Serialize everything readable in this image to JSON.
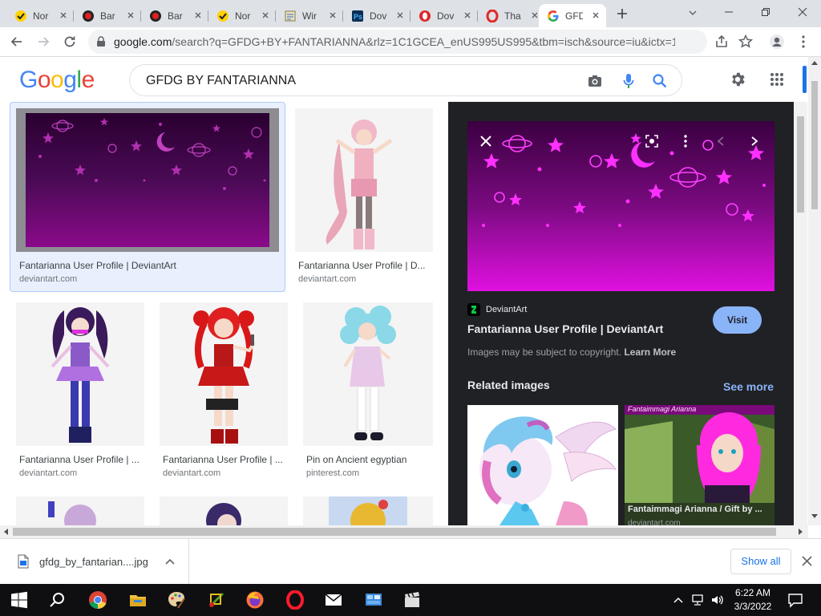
{
  "browser": {
    "tabs": [
      {
        "title": "Nor",
        "favicon": "norton-check-icon",
        "active": false
      },
      {
        "title": "Bar",
        "favicon": "record-icon",
        "active": false
      },
      {
        "title": "Bar",
        "favicon": "record-icon",
        "active": false
      },
      {
        "title": "Nor",
        "favicon": "norton-check-icon",
        "active": false
      },
      {
        "title": "Wir",
        "favicon": "wordpad-icon",
        "active": false
      },
      {
        "title": "Dov",
        "favicon": "ps-icon",
        "active": false
      },
      {
        "title": "Dov",
        "favicon": "opera-q-icon",
        "active": false
      },
      {
        "title": "Tha",
        "favicon": "opera-icon",
        "active": false
      },
      {
        "title": "GFD",
        "favicon": "google-g-icon",
        "active": true
      }
    ],
    "url_host": "google.com",
    "url_rest": "/search?q=GFDG+BY+FANTARIANNA&rlz=1C1GCEA_enUS995US995&tbm=isch&source=iu&ictx=1&vet..."
  },
  "google": {
    "logo": "Google",
    "query": "GFDG BY FANTARIANNA"
  },
  "results": [
    {
      "caption": "Fantarianna User Profile | DeviantArt",
      "source": "deviantart.com"
    },
    {
      "caption": "Fantarianna User Profile | D...",
      "source": "deviantart.com"
    },
    {
      "caption": "Fantarianna User Profile | ...",
      "source": "deviantart.com"
    },
    {
      "caption": "Fantarianna User Profile | ...",
      "source": "deviantart.com"
    },
    {
      "caption": "Pin on Ancient egyptian",
      "source": "pinterest.com"
    }
  ],
  "preview": {
    "site": "DeviantArt",
    "title": "Fantarianna User Profile | DeviantArt",
    "visit": "Visit",
    "copyright": "Images may be subject to copyright.",
    "learn_more": "Learn More",
    "related": "Related images",
    "see_more": "See more",
    "related_caption": "Fantaimmagi Arianna / Gift by ...",
    "related_source": "deviantart.com",
    "related_banner": "Fantaimmagi Arianna"
  },
  "downloads": {
    "file": "gfdg_by_fantarian....jpg",
    "show_all": "Show all"
  },
  "taskbar": {
    "time": "6:22 AM",
    "date": "3/3/2022"
  },
  "colors": {
    "accent": "#1a73e8",
    "dark_panel": "#202124",
    "visit_button": "#8ab4f8",
    "banner_purple": "#7a0a7a"
  }
}
